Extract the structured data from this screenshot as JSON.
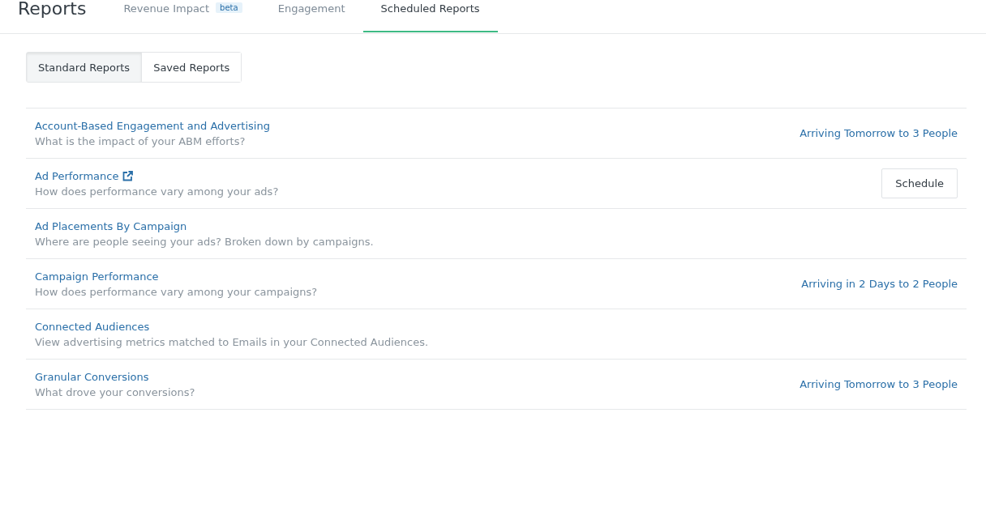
{
  "header": {
    "title": "Reports",
    "tabs": [
      {
        "label": "Revenue Impact",
        "badge": "beta",
        "selected": false
      },
      {
        "label": "Engagement",
        "selected": false
      },
      {
        "label": "Scheduled Reports",
        "selected": true
      }
    ]
  },
  "segments": [
    {
      "label": "Standard Reports",
      "selected": true
    },
    {
      "label": "Saved Reports",
      "selected": false
    }
  ],
  "reports": [
    {
      "title": "Account-Based Engagement and Advertising",
      "description": "What is the impact of your ABM efforts?",
      "external": false,
      "action": {
        "kind": "status",
        "text": "Arriving Tomorrow to 3 People"
      }
    },
    {
      "title": "Ad Performance",
      "description": "How does performance vary among your ads?",
      "external": true,
      "action": {
        "kind": "button",
        "text": "Schedule"
      }
    },
    {
      "title": "Ad Placements By Campaign",
      "description": "Where are people seeing your ads? Broken down by campaigns.",
      "external": false
    },
    {
      "title": "Campaign Performance",
      "description": "How does performance vary among your campaigns?",
      "external": false,
      "action": {
        "kind": "status",
        "text": "Arriving in 2 Days to 2 People"
      }
    },
    {
      "title": "Connected Audiences",
      "description": "View advertising metrics matched to Emails in your Connected Audiences.",
      "external": false
    },
    {
      "title": "Granular Conversions",
      "description": "What drove your conversions?",
      "external": false,
      "action": {
        "kind": "status",
        "text": "Arriving Tomorrow to 3 People"
      }
    }
  ]
}
